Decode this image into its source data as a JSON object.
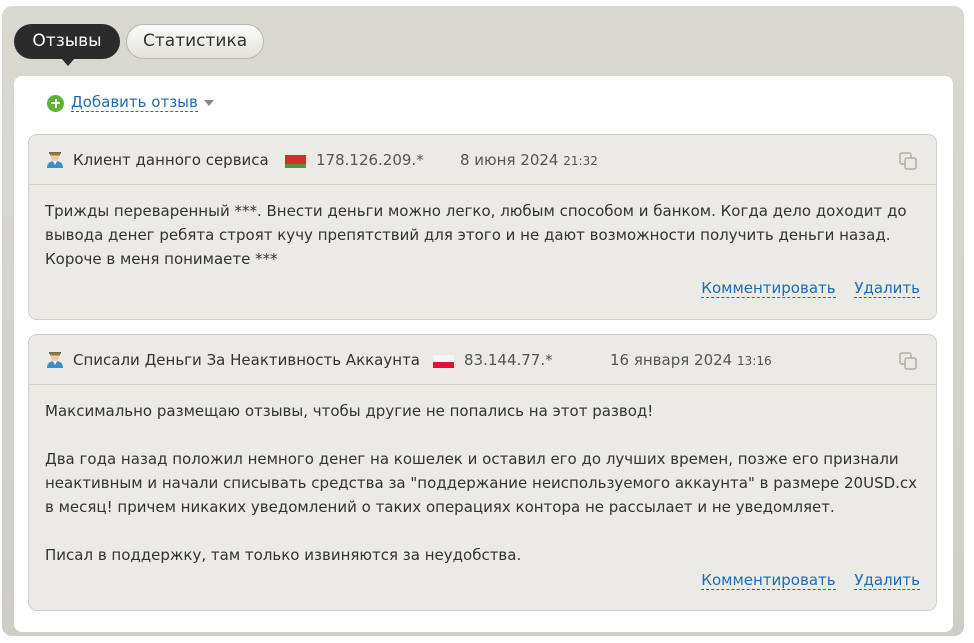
{
  "tabs": {
    "reviews": "Отзывы",
    "stats": "Статистика"
  },
  "add_review": "Добавить отзыв",
  "reviews": [
    {
      "author": "Клиент данного сервиса",
      "flag": "belarus",
      "ip": "178.126.209.*",
      "date": "8 июня 2024",
      "time": "21:32",
      "body": [
        "Трижды переваренный ***. Внести деньги можно легко, любым способом и банком. Когда дело доходит до вывода денег ребята строят кучу препятствий для этого и не дают возможности получить деньги назад. Короче в меня понимаете ***"
      ],
      "comment": "Комментировать",
      "delete": "Удалить"
    },
    {
      "author": "Списали Деньги За Неактивность Аккаунта",
      "flag": "poland",
      "ip": "83.144.77.*",
      "date": "16 января 2024",
      "time": "13:16",
      "body": [
        "Максимально размещаю отзывы, чтобы другие не попались на этот развод!",
        "Два года назад положил немного денег на кошелек и оставил его до лучших времен, позже его признали неактивным и начали списывать средства за \"поддержание неиспользуемого аккаунта\" в размере 20USD.cx в месяц! причем никаких уведомлений о таких операциях контора не рассылает и не уведомляет.",
        "Писал в поддержку, там только извиняются за неудобства."
      ],
      "comment": "Комментировать",
      "delete": "Удалить"
    }
  ],
  "colors": {
    "link": "#1f6bb5",
    "card_bg": "#ebeae5",
    "tab_active": "#2b2b2b"
  }
}
